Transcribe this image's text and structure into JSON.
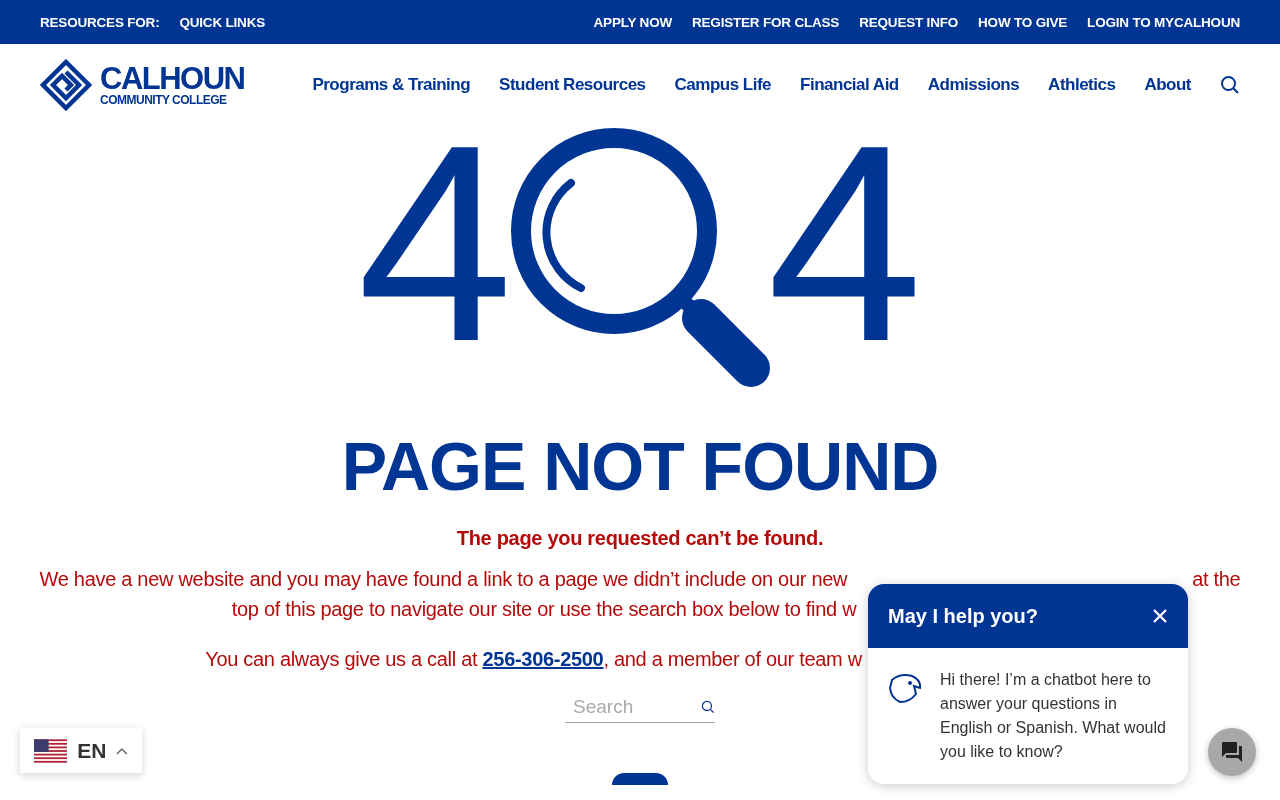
{
  "top_bar": {
    "left_links": [
      "RESOURCES FOR:",
      "QUICK LINKS"
    ],
    "right_links": [
      "APPLY NOW",
      "REGISTER FOR CLASS",
      "REQUEST INFO",
      "HOW TO GIVE",
      "LOGIN TO MYCALHOUN"
    ]
  },
  "logo": {
    "name": "CALHOUN",
    "subtitle": "COMMUNITY COLLEGE"
  },
  "nav": {
    "items": [
      "Programs & Training",
      "Student Resources",
      "Campus Life",
      "Financial Aid",
      "Admissions",
      "Athletics",
      "About"
    ]
  },
  "error": {
    "digits": [
      "4",
      "4"
    ],
    "title": "PAGE NOT FOUND",
    "subtitle": "The page you requested can’t be found.",
    "paragraph_lines": [
      {
        "before": "We have a new website and you may have found a link to a page we didn’t include on our new",
        "after": "at the"
      },
      {
        "before": "top of this page to navigate our site or use the search box below to find w"
      }
    ],
    "call_line": {
      "before": "You can always give us a call at ",
      "phone": "256-306-2500",
      "after": ", and a member of our team w"
    },
    "search": {
      "placeholder": "Search"
    }
  },
  "language": {
    "code": "EN"
  },
  "chat": {
    "title": "May I help you?",
    "message": "Hi there! I’m a chatbot here to answer your questions in English or Spanish. What would you like to know?"
  }
}
